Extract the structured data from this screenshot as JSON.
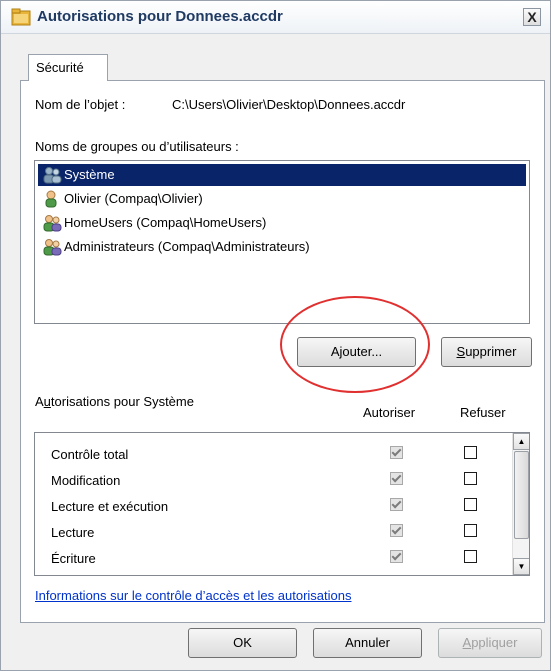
{
  "window": {
    "title": "Autorisations pour Donnees.accdr",
    "close_label": "X"
  },
  "tab": {
    "label": "Sécurité"
  },
  "object": {
    "label": "Nom de l’objet :",
    "value": "C:\\Users\\Olivier\\Desktop\\Donnees.accdr"
  },
  "groups": {
    "label": "Noms de groupes ou d’utilisateurs :",
    "items": [
      {
        "label": "Système",
        "icon": "group-icon",
        "selected": true
      },
      {
        "label": "Olivier (Compaq\\Olivier)",
        "icon": "user-icon",
        "selected": false
      },
      {
        "label": "HomeUsers (Compaq\\HomeUsers)",
        "icon": "group-icon",
        "selected": false
      },
      {
        "label": "Administrateurs (Compaq\\Administrateurs)",
        "icon": "group-icon",
        "selected": false
      }
    ]
  },
  "buttons": {
    "add": "Ajouter...",
    "remove": "Supprimer",
    "ok": "OK",
    "cancel": "Annuler",
    "apply": "Appliquer"
  },
  "permissions": {
    "label": "Autorisations pour Système",
    "allow_header": "Autoriser",
    "deny_header": "Refuser",
    "rows": [
      {
        "label": "Contrôle total",
        "allow": true,
        "deny": false
      },
      {
        "label": "Modification",
        "allow": true,
        "deny": false
      },
      {
        "label": "Lecture et exécution",
        "allow": true,
        "deny": false
      },
      {
        "label": "Lecture",
        "allow": true,
        "deny": false
      },
      {
        "label": "Écriture",
        "allow": true,
        "deny": false
      }
    ]
  },
  "info_link": "Informations sur le contrôle d’accès et les autorisations",
  "colors": {
    "selection": "#0a246a",
    "highlight_ellipse": "#e03030",
    "link": "#0033cc"
  }
}
